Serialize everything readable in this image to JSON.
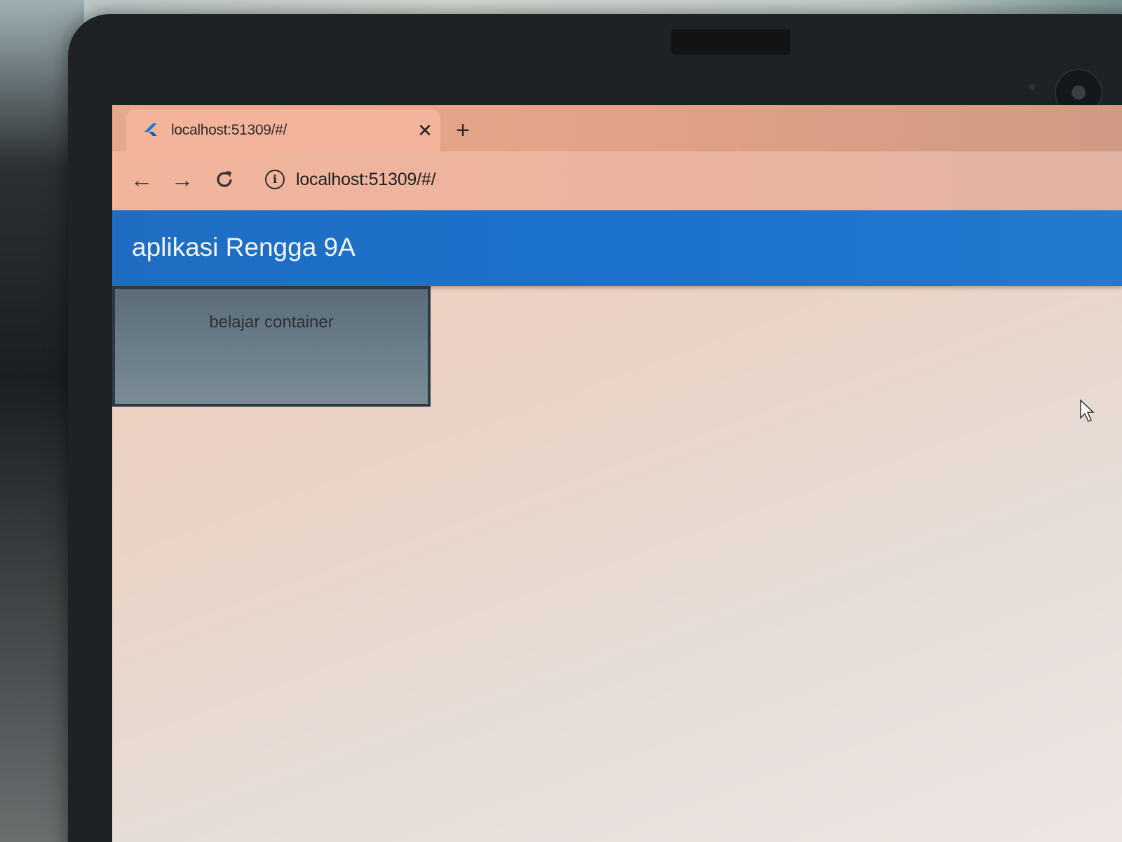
{
  "browser": {
    "tab": {
      "title": "localhost:51309/#/",
      "close_icon": "close-icon"
    },
    "new_tab_icon": "plus-icon",
    "toolbar": {
      "back_icon": "arrow-left-icon",
      "forward_icon": "arrow-right-icon",
      "reload_icon": "reload-icon",
      "info_icon": "info-icon",
      "url": "localhost:51309/#/"
    }
  },
  "app": {
    "title": "aplikasi Rengga 9A",
    "appbar_color": "#1c72cc",
    "container": {
      "text": "belajar container",
      "color": "#6b7d88"
    }
  }
}
